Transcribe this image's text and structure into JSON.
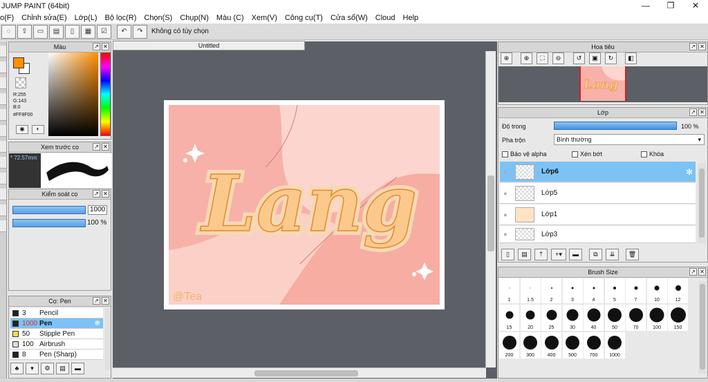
{
  "window": {
    "title": "JUMP PAINT (64bit)",
    "controls": [
      "—",
      "❐",
      "✕"
    ]
  },
  "menu": [
    "o(F)",
    "Chỉnh sửa(E)",
    "Lớp(L)",
    "Bộ lọc(R)",
    "Chọn(S)",
    "Chụp(N)",
    "Màu (C)",
    "Xem(V)",
    "Công cụ(T)",
    "Cửa sổ(W)",
    "Cloud",
    "Help"
  ],
  "toolbar": {
    "selection_status": "Không có tùy chọn"
  },
  "color_panel": {
    "title": "Màu",
    "r": "R:255",
    "g": "G:143",
    "b": "B:0",
    "hex": "#FF8F00",
    "fg_color": "#FF8F00"
  },
  "brush_preview": {
    "title": "Xem trước cọ",
    "size": "* 72.57mm"
  },
  "brush_control": {
    "title": "Kiểm soát cọ",
    "size_value": "1000",
    "opacity_value": "100 %"
  },
  "pen_panel": {
    "title": "Cọ: Pen",
    "items": [
      {
        "size": "3",
        "name": "Pencil",
        "color": "#222222"
      },
      {
        "size": "1000",
        "name": "Pen",
        "color": "#222222"
      },
      {
        "size": "50",
        "name": "Stipple Pen",
        "color": "#f5e23a"
      },
      {
        "size": "100",
        "name": "Airbrush",
        "color": "#dddddd"
      },
      {
        "size": "8",
        "name": "Pen (Sharp)",
        "color": "#222222"
      }
    ]
  },
  "document": {
    "tab": "Untitled",
    "art_text": "Lang",
    "signature": "@Tea"
  },
  "navigator": {
    "title": "Hoa tiêu"
  },
  "layer_panel": {
    "title": "Lớp",
    "opacity_label": "Độ trong",
    "opacity_value": "100 %",
    "blend_label": "Pha trộn",
    "blend_value": "Bình thường",
    "protect_alpha": "Bảo vệ alpha",
    "clipping": "Xén bớt",
    "lock": "Khóa",
    "layers": [
      "Lớp6",
      "Lớp5",
      "Lớp1",
      "Lớp3"
    ]
  },
  "brush_size": {
    "title": "Brush Size",
    "sizes": [
      "1",
      "1.5",
      "2",
      "3",
      "4",
      "5",
      "7",
      "10",
      "12",
      "15",
      "20",
      "25",
      "30",
      "40",
      "50",
      "70",
      "100",
      "150",
      "200",
      "300",
      "400",
      "500",
      "700",
      "1000"
    ]
  }
}
